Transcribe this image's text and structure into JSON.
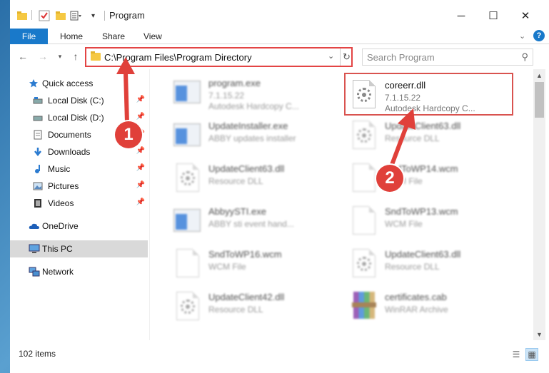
{
  "window": {
    "title": "Program",
    "controls": {
      "minimize": "─",
      "maximize": "☐",
      "close": "✕"
    }
  },
  "ribbon": {
    "tabs": [
      "File",
      "Home",
      "Share",
      "View"
    ]
  },
  "address": {
    "path": "C:\\Program Files\\Program Directory"
  },
  "search": {
    "placeholder": "Search Program"
  },
  "nav": {
    "quick_access": "Quick access",
    "items": [
      {
        "label": "Local Disk (C:)",
        "icon": "drive-icon",
        "pinned": true
      },
      {
        "label": "Local Disk (D:)",
        "icon": "drive-icon",
        "pinned": true
      },
      {
        "label": "Documents",
        "icon": "documents-icon",
        "pinned": true
      },
      {
        "label": "Downloads",
        "icon": "downloads-icon",
        "pinned": true
      },
      {
        "label": "Music",
        "icon": "music-icon",
        "pinned": true
      },
      {
        "label": "Pictures",
        "icon": "pictures-icon",
        "pinned": true
      },
      {
        "label": "Videos",
        "icon": "videos-icon",
        "pinned": true
      }
    ],
    "onedrive": "OneDrive",
    "this_pc": "This PC",
    "network": "Network"
  },
  "files": [
    {
      "name": "program.exe",
      "line1": "7.1.15.22",
      "line2": "Autodesk Hardcopy C...",
      "icon": "exe"
    },
    {
      "name": "coreerr.dll",
      "line1": "7.1.15.22",
      "line2": "Autodesk Hardcopy C...",
      "icon": "dll",
      "highlighted": true
    },
    {
      "name": "UpdateInstaller.exe",
      "line1": "ABBY updates installer",
      "line2": "",
      "icon": "exe"
    },
    {
      "name": "UpdateClient63.dll",
      "line1": "Resource DLL",
      "line2": "",
      "icon": "dll"
    },
    {
      "name": "UpdateClient63.dll",
      "line1": "Resource DLL",
      "line2": "",
      "icon": "dll"
    },
    {
      "name": "SndToWP14.wcm",
      "line1": "WCM File",
      "line2": "",
      "icon": "doc"
    },
    {
      "name": "AbbyySTI.exe",
      "line1": "ABBY sti event hand...",
      "line2": "",
      "icon": "exe"
    },
    {
      "name": "SndToWP13.wcm",
      "line1": "WCM File",
      "line2": "",
      "icon": "doc"
    },
    {
      "name": "SndToWP16.wcm",
      "line1": "WCM File",
      "line2": "",
      "icon": "doc"
    },
    {
      "name": "UpdateClient63.dll",
      "line1": "Resource DLL",
      "line2": "",
      "icon": "dll"
    },
    {
      "name": "UpdateClient42.dll",
      "line1": "Resource DLL",
      "line2": "",
      "icon": "dll"
    },
    {
      "name": "certificates.cab",
      "line1": "WinRAR Archive",
      "line2": "",
      "icon": "rar"
    }
  ],
  "status": {
    "item_count": "102 items"
  },
  "callouts": [
    "1",
    "2"
  ],
  "colors": {
    "accent": "#1979ca",
    "highlight_border": "#e34444",
    "callout": "#e0403a"
  }
}
